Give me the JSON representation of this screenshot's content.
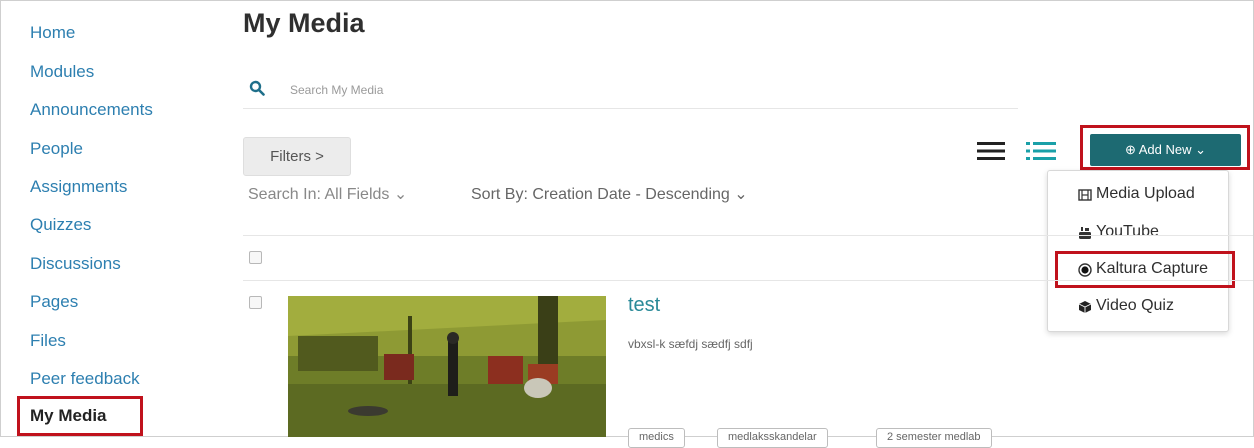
{
  "sidebar": {
    "items": [
      {
        "label": "Home"
      },
      {
        "label": "Modules"
      },
      {
        "label": "Announcements"
      },
      {
        "label": "People"
      },
      {
        "label": "Assignments"
      },
      {
        "label": "Quizzes"
      },
      {
        "label": "Discussions"
      },
      {
        "label": "Pages"
      },
      {
        "label": "Files"
      },
      {
        "label": "Peer feedback"
      },
      {
        "label": "My Media"
      }
    ],
    "active": "My Media"
  },
  "page": {
    "title": "My Media"
  },
  "search": {
    "placeholder": "Search My Media",
    "value": ""
  },
  "filters": {
    "button_label": "Filters  >",
    "search_in": "Search In: All Fields ⌄",
    "sort_by": "Sort By: Creation Date - Descending ⌄"
  },
  "toolbar": {
    "add_new_label": "⊕ Add New  ⌄",
    "view_modes": [
      "list-view-icon",
      "detailed-view-icon"
    ]
  },
  "add_new_menu": {
    "items": [
      {
        "label": "Media Upload",
        "icon": "film-icon"
      },
      {
        "label": "YouTube",
        "icon": "youtube-icon"
      },
      {
        "label": "Kaltura Capture",
        "icon": "record-icon"
      },
      {
        "label": "Video Quiz",
        "icon": "cube-icon"
      }
    ],
    "highlighted": "Kaltura Capture"
  },
  "entries": [
    {
      "title": "test",
      "description": "vbxsl-k sæfdj sædfj sdfj",
      "tags": [
        "medics",
        "medlaksskandelar",
        "2 semester medlab"
      ]
    }
  ],
  "colors": {
    "accent": "#1d6a72",
    "link": "#2d7fb0",
    "highlight_border": "#c0121c",
    "title_link": "#2a8a98"
  }
}
